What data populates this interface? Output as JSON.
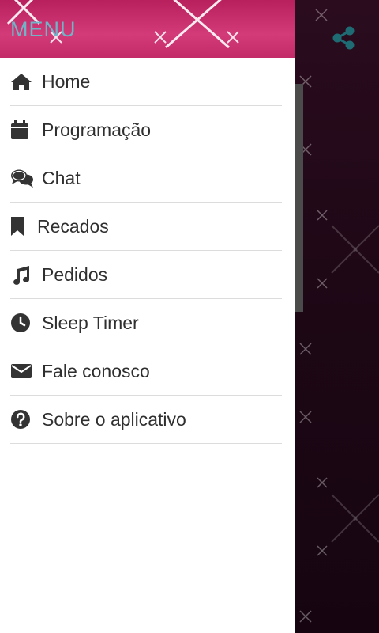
{
  "drawer": {
    "title": "MENU",
    "items": [
      {
        "label": "Home",
        "icon": "home-icon"
      },
      {
        "label": "Programação",
        "icon": "calendar-icon"
      },
      {
        "label": "Chat",
        "icon": "chat-icon"
      },
      {
        "label": "Recados",
        "icon": "bookmark-icon"
      },
      {
        "label": "Pedidos",
        "icon": "music-note-icon"
      },
      {
        "label": "Sleep Timer",
        "icon": "clock-icon"
      },
      {
        "label": "Fale conosco",
        "icon": "envelope-icon"
      },
      {
        "label": "Sobre o aplicativo",
        "icon": "question-circle-icon"
      }
    ]
  },
  "background": {
    "share_icon": "share-icon"
  },
  "colors": {
    "header_pink": "#c22a68",
    "title_teal": "#6fb4c7",
    "icon_dark": "#333333",
    "share_teal": "#1f6b73",
    "backdrop": "#1d0715"
  }
}
